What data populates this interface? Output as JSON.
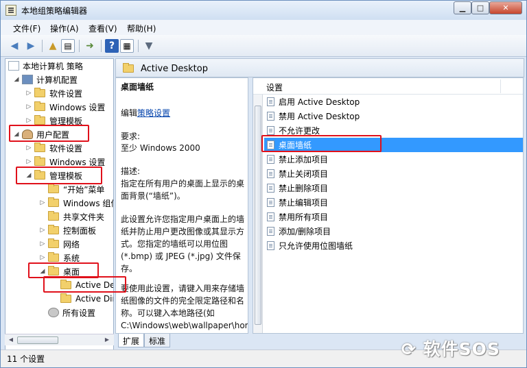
{
  "window": {
    "title": "本地组策略编辑器"
  },
  "controls": {
    "minimize": "▁",
    "maximize": "□",
    "close": "✕"
  },
  "menu": [
    "文件(F)",
    "操作(A)",
    "查看(V)",
    "帮助(H)"
  ],
  "tree": [
    {
      "label": "本地计算机 策略",
      "icon": "doc-icon"
    },
    {
      "label": "计算机配置",
      "icon": "computer-icon"
    },
    {
      "label": "软件设置",
      "icon": "folder-icon"
    },
    {
      "label": "Windows 设置",
      "icon": "folder-icon"
    },
    {
      "label": "管理模板",
      "icon": "folder-icon"
    },
    {
      "label": "用户配置",
      "icon": "user-icon"
    },
    {
      "label": "软件设置",
      "icon": "folder-icon"
    },
    {
      "label": "Windows 设置",
      "icon": "folder-icon"
    },
    {
      "label": "管理模板",
      "icon": "folder-icon"
    },
    {
      "label": "“开始”菜单",
      "icon": "folder-icon"
    },
    {
      "label": "Windows 组件",
      "icon": "folder-icon"
    },
    {
      "label": "共享文件夹",
      "icon": "folder-icon"
    },
    {
      "label": "控制面板",
      "icon": "folder-icon"
    },
    {
      "label": "网络",
      "icon": "folder-icon"
    },
    {
      "label": "系统",
      "icon": "folder-icon"
    },
    {
      "label": "桌面",
      "icon": "folder-icon"
    },
    {
      "label": "Active Desktop",
      "icon": "folder-icon"
    },
    {
      "label": "Active Directory",
      "icon": "folder-icon"
    },
    {
      "label": "所有设置",
      "icon": "settings-icon"
    }
  ],
  "right_header": {
    "title": "Active Desktop"
  },
  "description": {
    "title": "桌面墙纸",
    "edit_prefix": "编辑",
    "edit_link": "策略设置",
    "requirement_label": "要求:",
    "requirement_value": "至少 Windows 2000",
    "desc_label": "描述:",
    "desc_text": "指定在所有用户的桌面上显示的桌面背景(“墙纸”)。",
    "para1": "此设置允许您指定用户桌面上的墙纸并防止用户更改图像或其显示方式。您指定的墙纸可以用位图(*.bmp) 或 JPEG (*.jpg) 文件保存。",
    "para2": "要使用此设置，请键入用来存储墙纸图像的文件的完全限定路径和名称。可以键入本地路径(如 C:\\Windows\\web\\wallpaper\\home.jpg)或 UNC 路径(如"
  },
  "list": {
    "column": "设置",
    "items": [
      "启用 Active Desktop",
      "禁用 Active Desktop",
      "不允许更改",
      "桌面墙纸",
      "禁止添加项目",
      "禁止关闭项目",
      "禁止删除项目",
      "禁止编辑项目",
      "禁用所有项目",
      "添加/删除项目",
      "只允许使用位图墙纸"
    ],
    "selected": "桌面墙纸"
  },
  "tabs": [
    "扩展",
    "标准"
  ],
  "status": "11 个设置",
  "watermark": "软件SOS",
  "colors": {
    "selection": "#3399ff",
    "highlight_box": "#e0101a"
  }
}
